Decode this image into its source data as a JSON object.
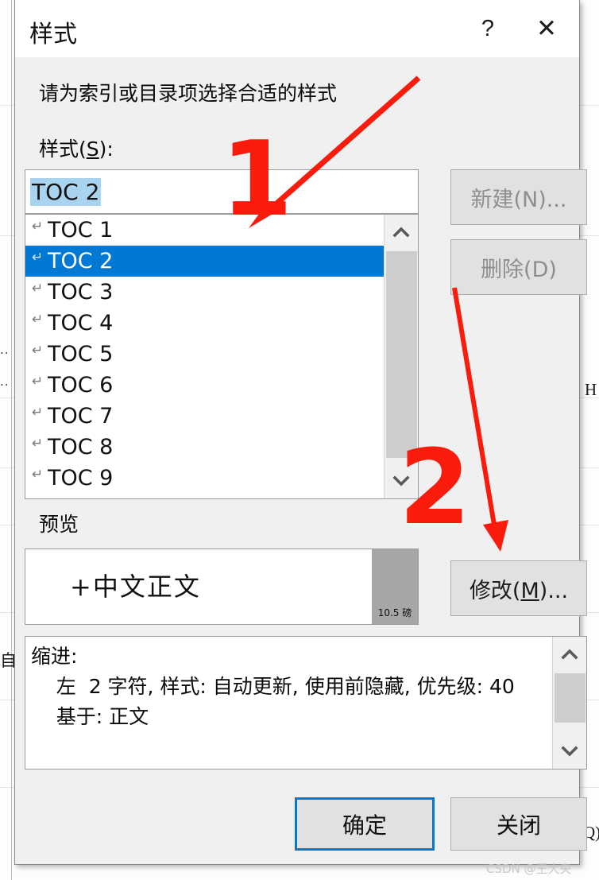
{
  "dialog": {
    "title": "样式",
    "help_icon": "question-mark-icon",
    "close_icon": "close-icon",
    "prompt": "请为索引或目录项选择合适的样式",
    "styles_label": "样式(S):",
    "preview_label": "预览"
  },
  "style_input": {
    "value": "TOC 2",
    "selection_color": "#a8d4f0"
  },
  "style_list": {
    "selected_index": 1,
    "selection_color": "#0078d4",
    "paragraph_mark": "↵",
    "items": [
      {
        "label": "TOC 1"
      },
      {
        "label": "TOC 2"
      },
      {
        "label": "TOC 3"
      },
      {
        "label": "TOC 4"
      },
      {
        "label": "TOC 5"
      },
      {
        "label": "TOC 6"
      },
      {
        "label": "TOC 7"
      },
      {
        "label": "TOC 8"
      },
      {
        "label": "TOC 9"
      }
    ]
  },
  "side_buttons": {
    "new_label": "新建(N)...",
    "new_enabled": false,
    "delete_label": "删除(D)",
    "delete_enabled": false,
    "modify_label": "修改(M)..."
  },
  "preview": {
    "text": "+中文正文",
    "font_size_chip": "10.5 磅"
  },
  "description": {
    "text": "缩进:\n    左  2 字符, 样式: 自动更新, 使用前隐藏, 优先级: 40\n    基于: 正文"
  },
  "footer": {
    "ok_label": "确定",
    "ok_focus_color": "#0078d4",
    "cancel_label": "关闭"
  },
  "annotations": [
    {
      "label": "1",
      "arrow": "arrow-to-style-list"
    },
    {
      "label": "2",
      "arrow": "arrow-to-modify-button"
    }
  ],
  "watermark": "CSDN @王大央",
  "background": {
    "fragment_right_top": "H",
    "fragment_right_bottom": "Q)",
    "fragment_left": "自",
    "dots": ".."
  }
}
